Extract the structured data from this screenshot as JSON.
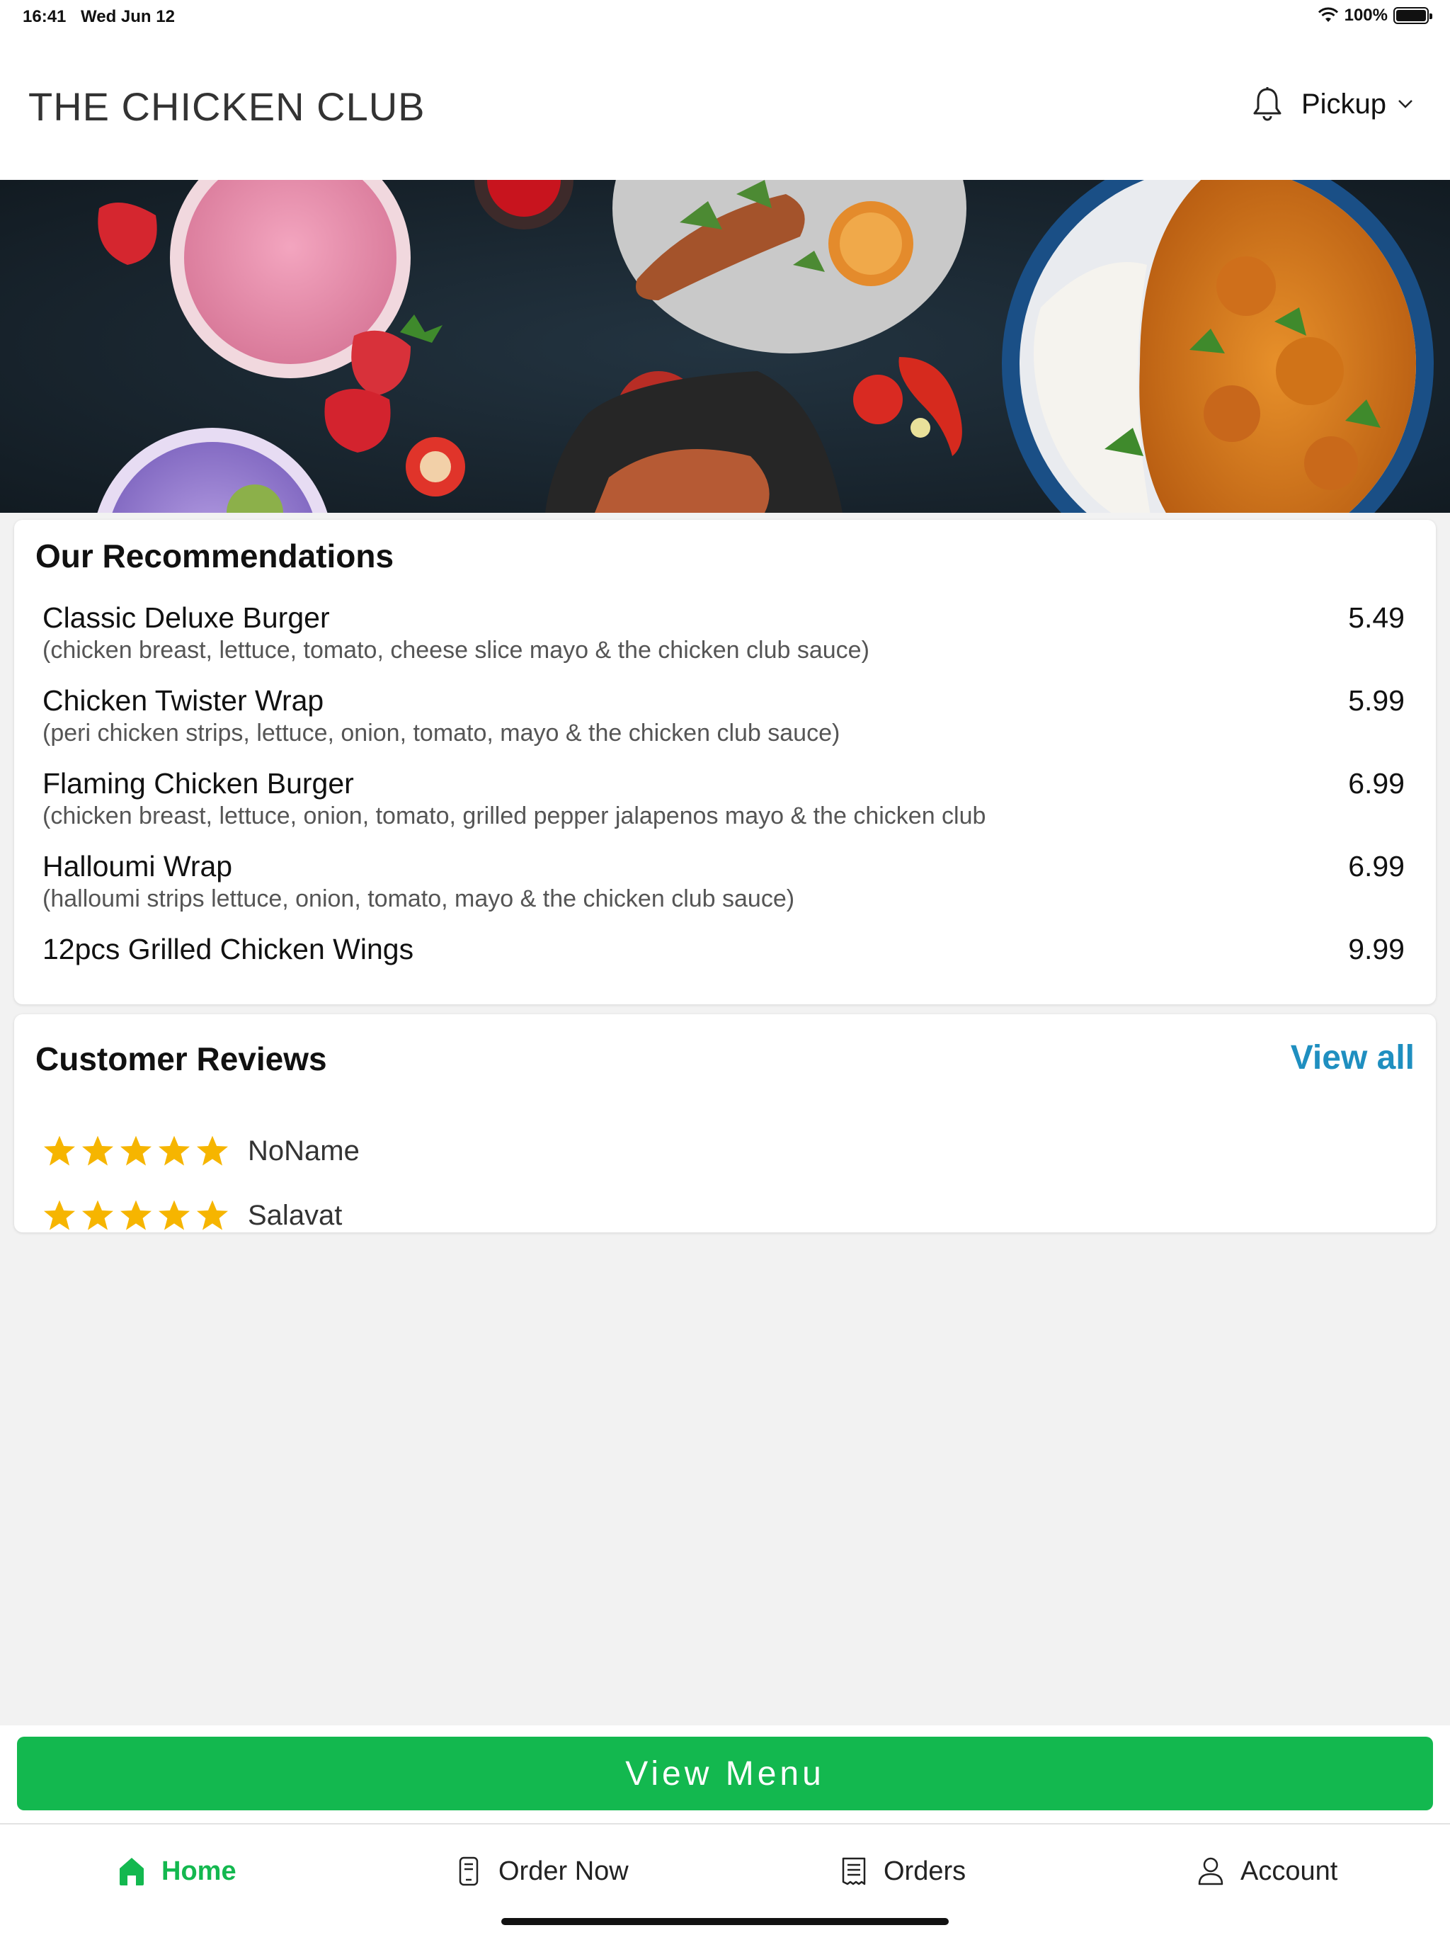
{
  "status_bar": {
    "time": "16:41",
    "date": "Wed Jun 12",
    "battery": "100%"
  },
  "header": {
    "title": "THE CHICKEN CLUB",
    "order_mode": "Pickup"
  },
  "recommendations": {
    "title": "Our Recommendations",
    "items": [
      {
        "name": "Classic Deluxe Burger",
        "description": "(chicken breast, lettuce, tomato, cheese slice mayo & the chicken club sauce)",
        "price": "5.49"
      },
      {
        "name": "Chicken Twister Wrap",
        "description": "(peri chicken strips, lettuce, onion, tomato, mayo & the chicken club sauce)",
        "price": "5.99"
      },
      {
        "name": "Flaming Chicken Burger",
        "description": "(chicken breast, lettuce, onion, tomato, grilled pepper jalapenos mayo & the chicken club",
        "price": "6.99"
      },
      {
        "name": "Halloumi Wrap",
        "description": "(halloumi strips  lettuce, onion, tomato, mayo & the chicken club sauce)",
        "price": "6.99"
      },
      {
        "name": "12pcs Grilled Chicken Wings",
        "description": "",
        "price": "9.99"
      }
    ]
  },
  "reviews": {
    "title": "Customer Reviews",
    "view_all_label": "View all",
    "items": [
      {
        "name": "NoName",
        "rating": 5
      },
      {
        "name": "Salavat",
        "rating": 5
      }
    ]
  },
  "cta": {
    "view_menu_label": "View Menu"
  },
  "tab_bar": {
    "tabs": [
      {
        "label": "Home",
        "icon": "home-icon",
        "active": true
      },
      {
        "label": "Order Now",
        "icon": "order-icon",
        "active": false
      },
      {
        "label": "Orders",
        "icon": "receipt-icon",
        "active": false
      },
      {
        "label": "Account",
        "icon": "user-icon",
        "active": false
      }
    ]
  },
  "colors": {
    "accent_green": "#13b84f",
    "link_blue": "#1f8fc0",
    "star_gold": "#f6b500"
  }
}
